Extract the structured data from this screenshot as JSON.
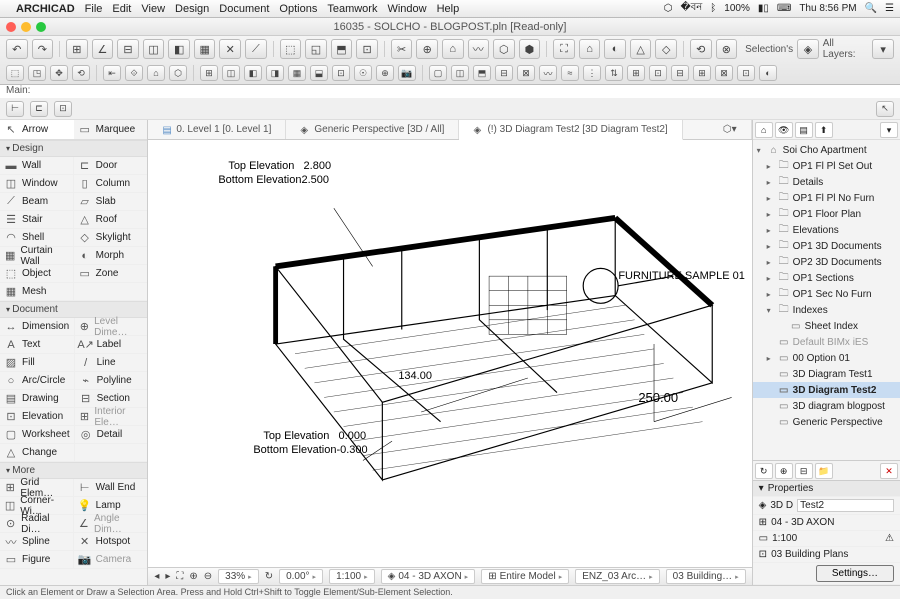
{
  "menubar": {
    "app": "ARCHICAD",
    "items": [
      "File",
      "Edit",
      "View",
      "Design",
      "Document",
      "Options",
      "Teamwork",
      "Window",
      "Help"
    ],
    "battery": "100%",
    "clock": "Thu 8:56 PM"
  },
  "window": {
    "title": "16035 - SOLCHO - BLOGPOST.pln [Read-only]"
  },
  "toolbar": {
    "selections_label": "Selection's",
    "layers_label": "All Layers:",
    "main_label": "Main:"
  },
  "toolbox": {
    "arrow": "Arrow",
    "marquee": "Marquee",
    "sections": {
      "design": {
        "label": "Design",
        "tools": [
          [
            "Wall",
            "Door"
          ],
          [
            "Window",
            "Column"
          ],
          [
            "Beam",
            "Slab"
          ],
          [
            "Stair",
            "Roof"
          ],
          [
            "Shell",
            "Skylight"
          ],
          [
            "Curtain Wall",
            "Morph"
          ],
          [
            "Object",
            "Zone"
          ],
          [
            "Mesh",
            ""
          ]
        ]
      },
      "document": {
        "label": "Document",
        "tools": [
          [
            "Dimension",
            "Level Dime…"
          ],
          [
            "Text",
            "Label"
          ],
          [
            "Fill",
            "Line"
          ],
          [
            "Arc/Circle",
            "Polyline"
          ],
          [
            "Drawing",
            "Section"
          ],
          [
            "Elevation",
            "Interior Ele…"
          ],
          [
            "Worksheet",
            "Detail"
          ],
          [
            "Change",
            ""
          ]
        ]
      },
      "more": {
        "label": "More",
        "tools": [
          [
            "Grid Elem…",
            "Wall End"
          ],
          [
            "Corner-Wi…",
            "Lamp"
          ],
          [
            "Radial Di…",
            "Angle Dim…"
          ],
          [
            "Spline",
            "Hotspot"
          ],
          [
            "Figure",
            "Camera"
          ]
        ]
      }
    }
  },
  "tabs": [
    {
      "label": "0. Level 1 [0. Level 1]",
      "icon": "plan"
    },
    {
      "label": "Generic Perspective [3D / All]",
      "icon": "3d"
    },
    {
      "label": "(!) 3D Diagram Test2 [3D Diagram Test2]",
      "icon": "3d",
      "active": true
    }
  ],
  "canvas": {
    "top_elev_1_label": "Top Elevation",
    "top_elev_1_val": "2.800",
    "bot_elev_1": "Bottom Elevation2.500",
    "furniture": "FURNITURE SAMPLE 01",
    "dim_134": "134.00",
    "top_elev_2_label": "Top Elevation",
    "top_elev_2_val": "0.000",
    "bot_elev_2": "Bottom Elevation-0.300",
    "dim_250": "250.00"
  },
  "status": {
    "zoom": "33%",
    "angle": "0.00°",
    "scale": "1:100",
    "view": "04 - 3D AXON",
    "model": "Entire Model",
    "arc": "ENZ_03 Arc…",
    "building": "03 Building…"
  },
  "navigator": {
    "root": "Soi Cho Apartment",
    "items": [
      {
        "label": "OP1 Fl Pl Set Out",
        "depth": 1,
        "tri": "▸",
        "ico": "📁"
      },
      {
        "label": "Details",
        "depth": 1,
        "tri": "▸",
        "ico": "📁"
      },
      {
        "label": "OP1 Fl Pl No Furn",
        "depth": 1,
        "tri": "▸",
        "ico": "📁"
      },
      {
        "label": "OP1 Floor Plan",
        "depth": 1,
        "tri": "▸",
        "ico": "📁"
      },
      {
        "label": "Elevations",
        "depth": 1,
        "tri": "▸",
        "ico": "📁"
      },
      {
        "label": "OP1 3D Documents",
        "depth": 1,
        "tri": "▸",
        "ico": "📁"
      },
      {
        "label": "OP2 3D Documents",
        "depth": 1,
        "tri": "▸",
        "ico": "📁"
      },
      {
        "label": "OP1 Sections",
        "depth": 1,
        "tri": "▸",
        "ico": "📁"
      },
      {
        "label": "OP1 Sec No Furn",
        "depth": 1,
        "tri": "▸",
        "ico": "📁"
      },
      {
        "label": "Indexes",
        "depth": 1,
        "tri": "▾",
        "ico": "📁"
      },
      {
        "label": "Sheet Index",
        "depth": 2,
        "tri": "",
        "ico": "▭"
      },
      {
        "label": "Default BIMx iES",
        "depth": 1,
        "tri": "",
        "ico": "▭",
        "dim": true
      },
      {
        "label": "00 Option 01",
        "depth": 1,
        "tri": "▸",
        "ico": "▭"
      },
      {
        "label": "3D Diagram Test1",
        "depth": 1,
        "tri": "",
        "ico": "▭"
      },
      {
        "label": "3D Diagram Test2",
        "depth": 1,
        "tri": "",
        "ico": "▭",
        "selected": true
      },
      {
        "label": "3D diagram blogpost",
        "depth": 1,
        "tri": "",
        "ico": "▭"
      },
      {
        "label": "Generic Perspective",
        "depth": 1,
        "tri": "",
        "ico": "▭"
      }
    ],
    "properties": {
      "header": "Properties",
      "id_prefix": "3D D",
      "id_val": "Test2",
      "view": "04 - 3D AXON",
      "scale": "1:100",
      "plan": "03 Building Plans",
      "settings": "Settings…"
    }
  },
  "help": "Click an Element or Draw a Selection Area. Press and Hold Ctrl+Shift to Toggle Element/Sub-Element Selection."
}
